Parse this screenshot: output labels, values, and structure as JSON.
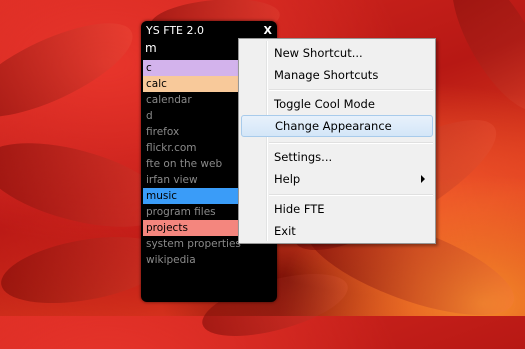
{
  "fte": {
    "title": "YS FTE 2.0",
    "close_label": "X",
    "input_value": "m",
    "items": [
      {
        "label": "c",
        "bg": "#d3b3ec"
      },
      {
        "label": "calc",
        "bg": "#f8c99a"
      },
      {
        "label": "calendar",
        "bg": ""
      },
      {
        "label": "d",
        "bg": ""
      },
      {
        "label": "firefox",
        "bg": ""
      },
      {
        "label": "flickr.com",
        "bg": ""
      },
      {
        "label": "fte on the web",
        "bg": ""
      },
      {
        "label": "irfan view",
        "bg": ""
      },
      {
        "label": "music",
        "bg": "#3a9cf8"
      },
      {
        "label": "program files",
        "bg": ""
      },
      {
        "label": "projects",
        "bg": "#f4867e"
      },
      {
        "label": "system properties",
        "bg": ""
      },
      {
        "label": "wikipedia",
        "bg": ""
      }
    ]
  },
  "menu": {
    "items": [
      {
        "label": "New Shortcut..."
      },
      {
        "label": "Manage Shortcuts"
      },
      {
        "label": "Toggle Cool Mode"
      },
      {
        "label": "Change Appearance"
      },
      {
        "label": "Settings..."
      },
      {
        "label": "Help"
      },
      {
        "label": "Hide FTE"
      },
      {
        "label": "Exit"
      }
    ],
    "highlighted": "Change Appearance"
  }
}
